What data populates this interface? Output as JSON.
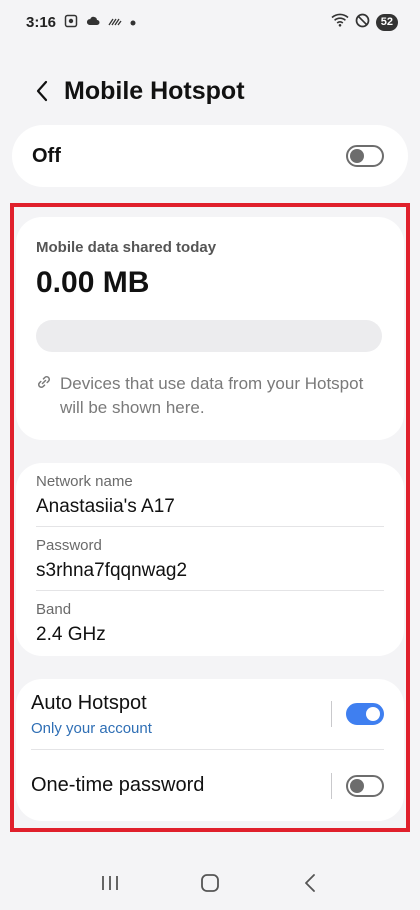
{
  "status_bar": {
    "time": "3:16",
    "battery": "52",
    "left_icons": [
      "screenshot-icon",
      "cloud-icon",
      "wifi-calling-icon",
      "notification-dot-icon"
    ],
    "right_icons": [
      "wifi-icon",
      "do-not-disturb-icon",
      "battery-icon"
    ]
  },
  "header": {
    "title": "Mobile Hotspot",
    "back_icon": "chevron-left-icon"
  },
  "master_switch": {
    "label": "Off",
    "state": "off"
  },
  "data_usage": {
    "label": "Mobile data shared today",
    "value": "0.00 MB",
    "usage_fraction": 0,
    "note": "Devices that use data from your Hotspot will be shown here.",
    "note_icon": "link-icon"
  },
  "network": {
    "rows": [
      {
        "label": "Network name",
        "value": "Anastasiia's A17"
      },
      {
        "label": "Password",
        "value": "s3rhna7fqqnwag2"
      },
      {
        "label": "Band",
        "value": "2.4 GHz"
      }
    ]
  },
  "settings": {
    "auto_hotspot": {
      "title": "Auto Hotspot",
      "subtitle": "Only your account",
      "state": "on"
    },
    "one_time_password": {
      "title": "One-time password",
      "state": "off"
    }
  },
  "nav_bar": {
    "icons": [
      "recent-apps-icon",
      "home-icon",
      "back-icon"
    ]
  },
  "colors": {
    "accent": "#3f7ff0",
    "highlight_border": "#e0202c",
    "subtitle_link": "#2f6fb5",
    "background": "#f4f4f6"
  }
}
